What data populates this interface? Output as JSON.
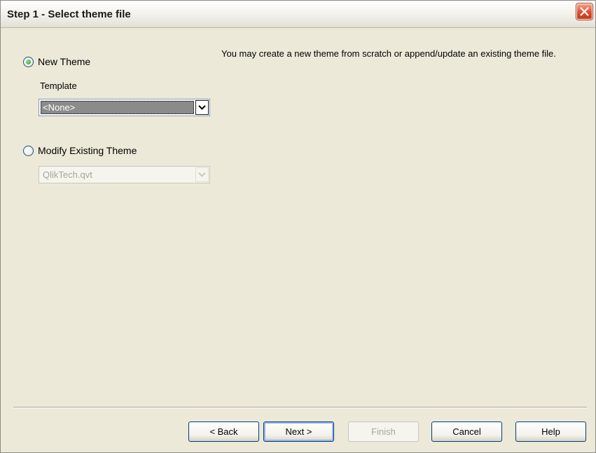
{
  "window": {
    "title": "Step 1 - Select theme file"
  },
  "left": {
    "new_theme_label": "New Theme",
    "template_label": "Template",
    "template_value": "<None>",
    "modify_label": "Modify Existing Theme",
    "existing_file_value": "QlikTech.qvt"
  },
  "description": "You may create a new theme from scratch or append/update an existing theme file.",
  "buttons": {
    "back": "< Back",
    "next": "Next >",
    "finish": "Finish",
    "cancel": "Cancel",
    "help": "Help"
  },
  "state": {
    "new_theme_selected": true,
    "modify_selected": false,
    "finish_enabled": false,
    "existing_file_enabled": false
  },
  "colors": {
    "accent": "#003c74",
    "close": "#d8502e",
    "radio_dot": "#21a121"
  }
}
